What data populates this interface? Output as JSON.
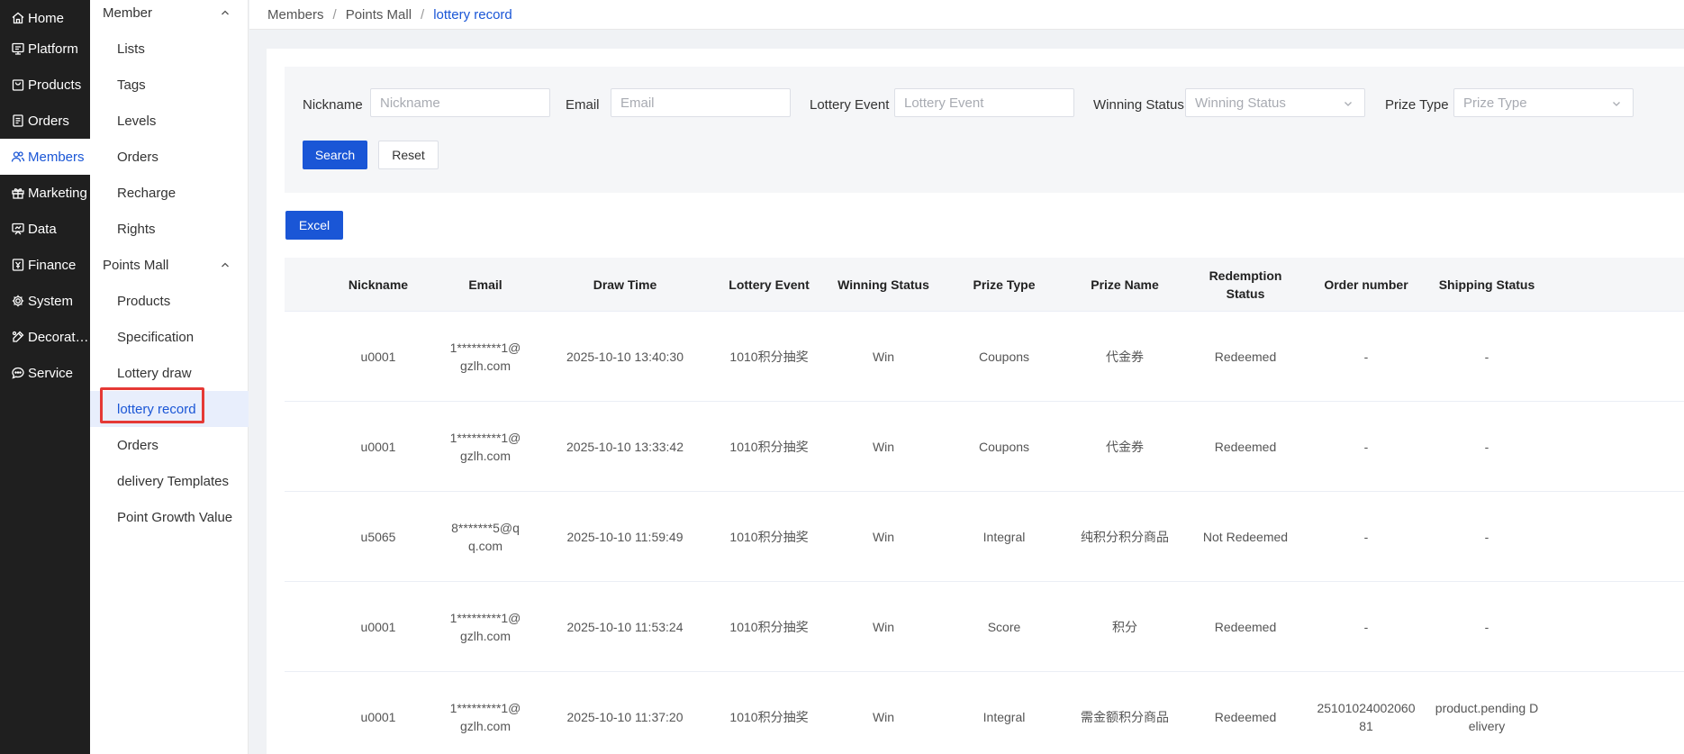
{
  "nav": {
    "items": [
      {
        "label": "Home",
        "icon": "home-icon"
      },
      {
        "label": "Platform",
        "icon": "monitor-icon"
      },
      {
        "label": "Products",
        "icon": "bag-icon"
      },
      {
        "label": "Orders",
        "icon": "document-icon"
      },
      {
        "label": "Members",
        "icon": "users-icon"
      },
      {
        "label": "Marketing",
        "icon": "gift-icon"
      },
      {
        "label": "Data",
        "icon": "presentation-icon"
      },
      {
        "label": "Finance",
        "icon": "wallet-icon"
      },
      {
        "label": "System",
        "icon": "gear-icon"
      },
      {
        "label": "Decorat…",
        "icon": "paint-icon"
      },
      {
        "label": "Service",
        "icon": "chat-icon"
      }
    ],
    "active": "Members"
  },
  "submenu": {
    "group1": "Member",
    "group1_items": [
      "Lists",
      "Tags",
      "Levels",
      "Orders",
      "Recharge",
      "Rights"
    ],
    "group2": "Points Mall",
    "group2_items": [
      "Products",
      "Specification",
      "Lottery draw",
      "lottery record",
      "Orders",
      "delivery Templates",
      "Point Growth Value"
    ],
    "active": "lottery record"
  },
  "breadcrumb": {
    "items": [
      "Members",
      "Points Mall"
    ],
    "separator": "/",
    "current": "lottery record"
  },
  "filter": {
    "nickname_label": "Nickname",
    "nickname_placeholder": "Nickname",
    "email_label": "Email",
    "email_placeholder": "Email",
    "event_label": "Lottery Event",
    "event_placeholder": "Lottery Event",
    "status_label": "Winning Status",
    "status_placeholder": "Winning Status",
    "prize_label": "Prize Type",
    "prize_placeholder": "Prize Type",
    "search_label": "Search",
    "reset_label": "Reset"
  },
  "excel_label": "Excel",
  "table": {
    "columns": [
      "Nickname",
      "Email",
      "Draw Time",
      "Lottery Event",
      "Winning Status",
      "Prize Type",
      "Prize Name",
      "Redemption Status",
      "Order number",
      "Shipping Status"
    ],
    "rows": [
      [
        "u0001",
        "1*********1@gzlh.com",
        "2025-10-10 13:40:30",
        "1010积分抽奖",
        "Win",
        "Coupons",
        "代金券",
        "Redeemed",
        "-",
        "-"
      ],
      [
        "u0001",
        "1*********1@gzlh.com",
        "2025-10-10 13:33:42",
        "1010积分抽奖",
        "Win",
        "Coupons",
        "代金券",
        "Redeemed",
        "-",
        "-"
      ],
      [
        "u5065",
        "8*******5@qq.com",
        "2025-10-10 11:59:49",
        "1010积分抽奖",
        "Win",
        "Integral",
        "纯积分积分商品",
        "Not Redeemed",
        "-",
        "-"
      ],
      [
        "u0001",
        "1*********1@gzlh.com",
        "2025-10-10 11:53:24",
        "1010积分抽奖",
        "Win",
        "Score",
        "积分",
        "Redeemed",
        "-",
        "-"
      ],
      [
        "u0001",
        "1*********1@gzlh.com",
        "2025-10-10 11:37:20",
        "1010积分抽奖",
        "Win",
        "Integral",
        "需金额积分商品",
        "Redeemed",
        "2510102400206081",
        "product.pending Delivery"
      ]
    ]
  },
  "colors": {
    "accent": "#1a56d6",
    "nav_bg": "#1f1f1f",
    "highlight": "#e53935"
  }
}
